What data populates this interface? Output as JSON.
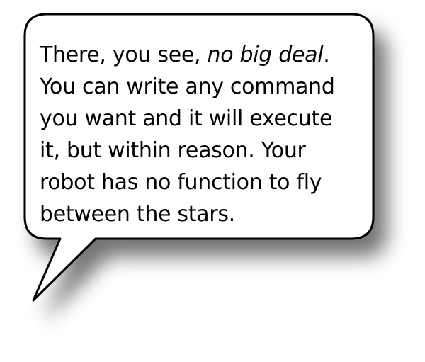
{
  "bubble": {
    "lines": [
      {
        "before": "There, you see, ",
        "emphasis": "no big deal",
        "after": "."
      },
      {
        "text": "You can write any command"
      },
      {
        "text": "you want and it will execute"
      },
      {
        "text": "it, but within reason. Your"
      },
      {
        "text": "robot has no function to fly"
      },
      {
        "text": "between the stars."
      }
    ],
    "fill_color": "#ffffff",
    "stroke_color": "#000000",
    "shadow_color": "#000000"
  }
}
